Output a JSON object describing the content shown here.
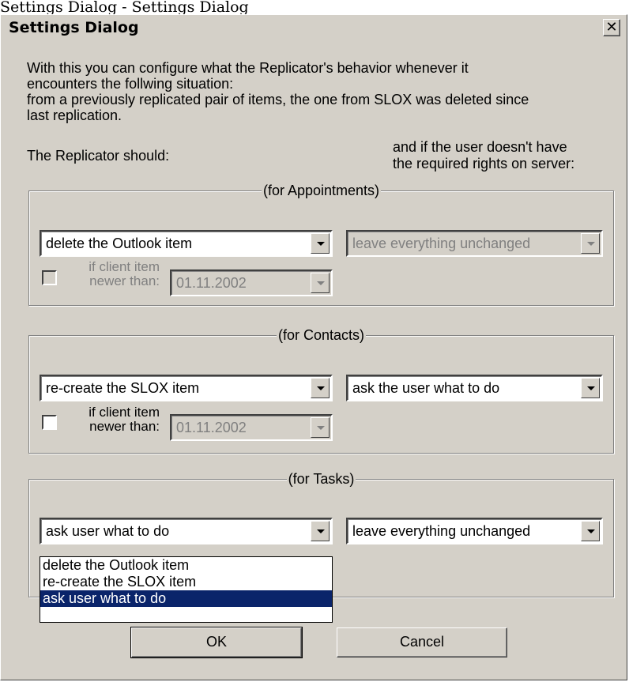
{
  "caption": "Settings Dialog - Settings Dialog",
  "window": {
    "title": "Settings Dialog",
    "close_glyph": "✕"
  },
  "intro": {
    "line1": "With this you can configure what the Replicator's behavior whenever it",
    "line2": "encounters the follwing situation:",
    "line3": "from a previously replicated pair of items, the one from SLOX was deleted since",
    "line4": "last replication."
  },
  "headers": {
    "replicator_should": "The Replicator should:",
    "no_rights_line1": "and if the user doesn't have",
    "no_rights_line2": "the required rights on server:"
  },
  "groups": {
    "appointments": {
      "label": "(for Appointments)",
      "action": "delete the Outlook item",
      "action_enabled": true,
      "no_rights": "leave everything unchanged",
      "no_rights_enabled": false,
      "checkbox_label_line1": "if client item",
      "checkbox_label_line2": "newer than:",
      "checkbox_checked": false,
      "checkbox_enabled": false,
      "date": "01.11.2002"
    },
    "contacts": {
      "label": "(for Contacts)",
      "action": "re-create the SLOX item",
      "action_enabled": true,
      "no_rights": "ask the user what to do",
      "no_rights_enabled": true,
      "checkbox_label_line1": "if client item",
      "checkbox_label_line2": "newer than:",
      "checkbox_checked": false,
      "checkbox_enabled": true,
      "date": "01.11.2002"
    },
    "tasks": {
      "label": "(for Tasks)",
      "action": "ask user what to do",
      "action_enabled": true,
      "no_rights": "leave everything unchanged",
      "no_rights_enabled": true,
      "dropdown_open": true,
      "options": [
        "delete the Outlook item",
        "re-create the SLOX item",
        "ask user what to do"
      ],
      "selected_option": "ask user what to do"
    }
  },
  "buttons": {
    "ok": "OK",
    "cancel": "Cancel"
  },
  "colors": {
    "dialog_bg": "#d4d0c8",
    "selection": "#0a246a",
    "disabled_text": "#808080"
  }
}
